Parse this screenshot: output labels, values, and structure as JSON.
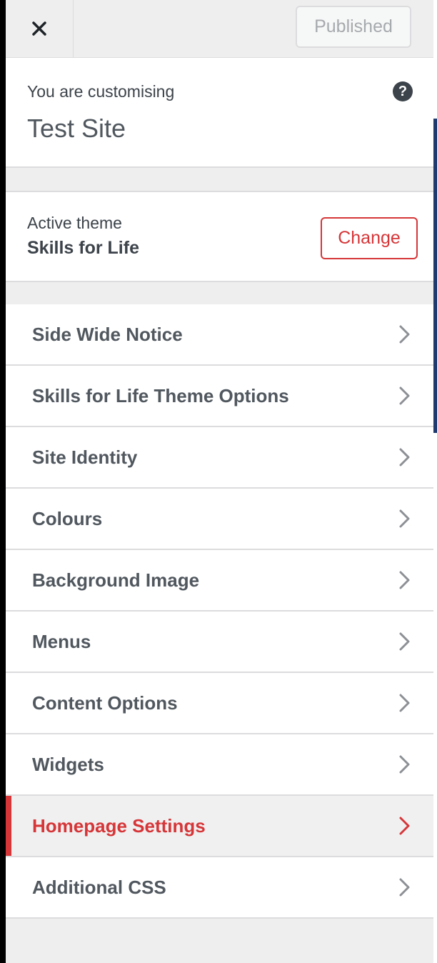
{
  "header": {
    "close_icon": "close-icon",
    "publish_label": "Published"
  },
  "info": {
    "label": "You are customising",
    "site_name": "Test Site",
    "help_icon": "help-icon",
    "help_glyph": "?"
  },
  "theme": {
    "label": "Active theme",
    "name": "Skills for Life",
    "change_label": "Change"
  },
  "menu": {
    "items": [
      {
        "label": "Side Wide Notice"
      },
      {
        "label": "Skills for Life Theme Options"
      },
      {
        "label": "Site Identity"
      },
      {
        "label": "Colours"
      },
      {
        "label": "Background Image"
      },
      {
        "label": "Menus"
      },
      {
        "label": "Content Options"
      },
      {
        "label": "Widgets"
      },
      {
        "label": "Homepage Settings",
        "active": true
      },
      {
        "label": "Additional CSS"
      }
    ],
    "chevron_icon": "chevron-right-icon"
  },
  "colors": {
    "accent": "#d63638",
    "text": "#50575e",
    "panel_bg": "#eeeeee"
  }
}
